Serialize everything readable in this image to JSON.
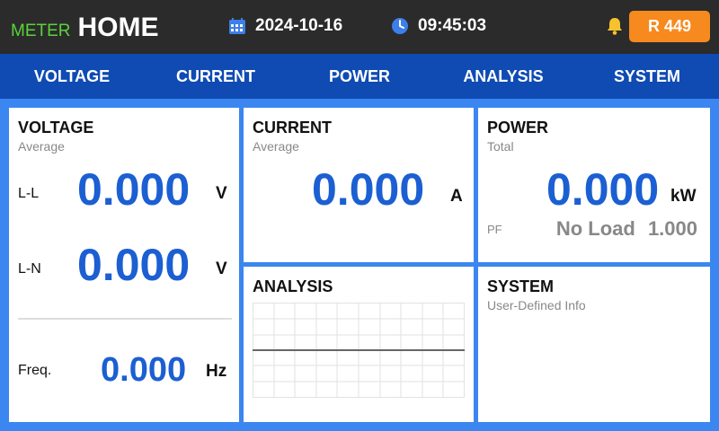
{
  "header": {
    "brand_prefix": "METER",
    "title": "HOME",
    "date": "2024-10-16",
    "time": "09:45:03",
    "alarm_label": "R 449",
    "colors": {
      "brand_prefix": "#5ad33a",
      "alarm_bg": "#f68a1e",
      "bell": "#f7c22e",
      "header_bg": "#2b2b2b"
    }
  },
  "nav": {
    "tabs": [
      "VOLTAGE",
      "CURRENT",
      "POWER",
      "ANALYSIS",
      "SYSTEM"
    ],
    "bg": "#0f4bb3"
  },
  "voltage": {
    "title": "VOLTAGE",
    "subtitle": "Average",
    "ll_label": "L-L",
    "ll_value": "0.000",
    "ll_unit": "V",
    "ln_label": "L-N",
    "ln_value": "0.000",
    "ln_unit": "V",
    "freq_label": "Freq.",
    "freq_value": "0.000",
    "freq_unit": "Hz"
  },
  "current": {
    "title": "CURRENT",
    "subtitle": "Average",
    "value": "0.000",
    "unit": "A"
  },
  "power": {
    "title": "POWER",
    "subtitle": "Total",
    "value": "0.000",
    "unit": "kW",
    "pf_label": "PF",
    "pf_status": "No Load",
    "pf_value": "1.000"
  },
  "analysis": {
    "title": "ANALYSIS"
  },
  "system": {
    "title": "SYSTEM",
    "subtitle": "User-Defined Info"
  },
  "icons": {
    "date": "calendar-icon",
    "time": "clock-icon",
    "alarm": "bell-icon"
  },
  "accent": "#1b5fd2"
}
